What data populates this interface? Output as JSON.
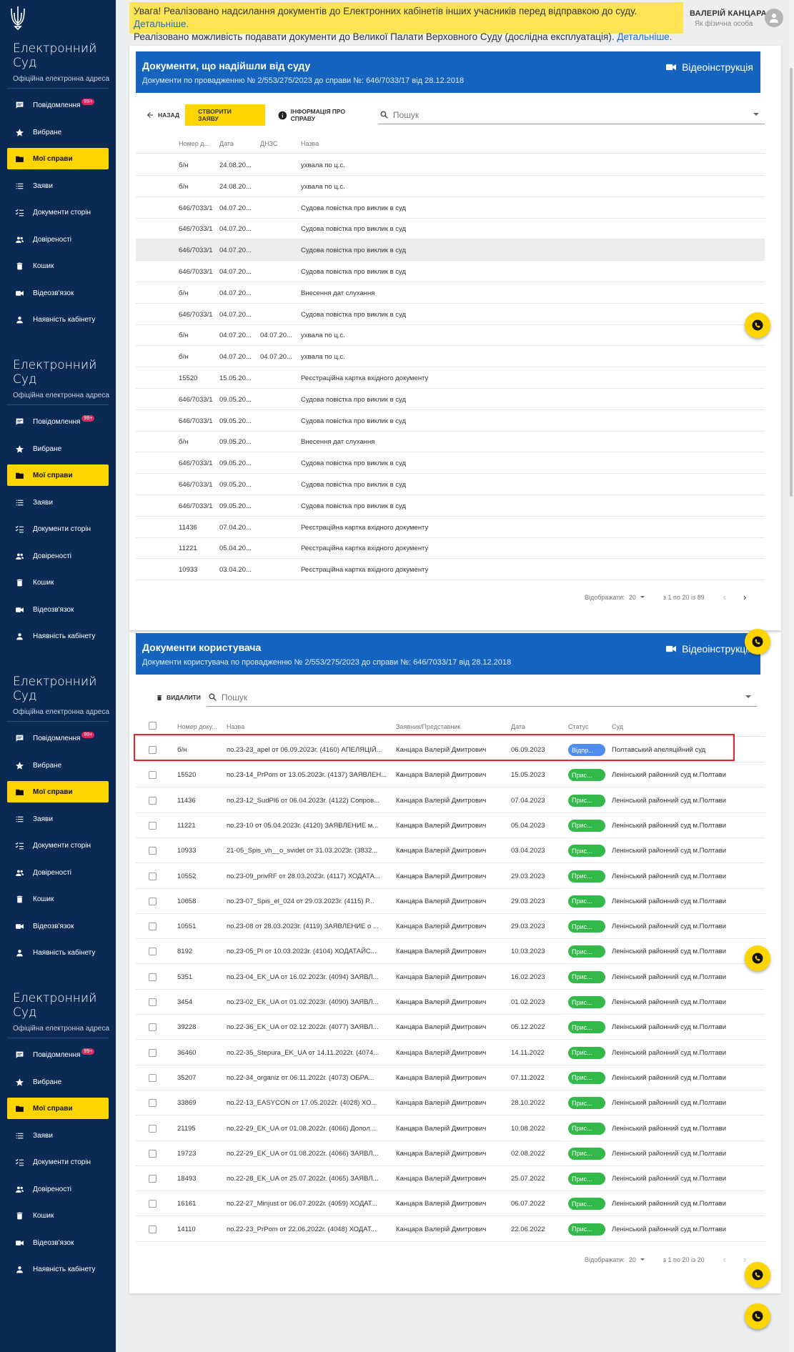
{
  "notice": {
    "line1": "Увага! Реалізовано надсилання документів до Електронних кабінетів інших учасників перед відправкою до суду.",
    "line2": "Реалізовано можливість подавати документи до Великої Палати Верховного Суду (дослідна експлуатація).",
    "link": "Детальніше."
  },
  "user": {
    "name": "ВАЛЕРІЙ КАНЦАРА",
    "role": "Як фізична особа"
  },
  "sidebar": {
    "title": "Електронний Суд",
    "subtitle": "Офіційна електронна адреса",
    "badge": "99+",
    "items": [
      {
        "label": "Повідомлення",
        "icon": "message-icon"
      },
      {
        "label": "Вибране",
        "icon": "star-icon"
      },
      {
        "label": "Мої справи",
        "icon": "folder-icon"
      },
      {
        "label": "Заяви",
        "icon": "list-icon"
      },
      {
        "label": "Документи сторін",
        "icon": "checklist-icon"
      },
      {
        "label": "Довіреності",
        "icon": "people-icon"
      },
      {
        "label": "Кошик",
        "icon": "trash-icon"
      },
      {
        "label": "Відеозв'язок",
        "icon": "video-icon"
      },
      {
        "label": "Наявність кабінету",
        "icon": "person-icon"
      }
    ]
  },
  "court_docs": {
    "title": "Документи, що надійшли від суду",
    "subtitle": "Документи по провадженню № 2/553/275/2023 до справи №: 646/7033/17 від 28.12.2018",
    "video": "Відеоінструкція",
    "back": "НАЗАД",
    "create": "СТВОРИТИ ЗАЯВУ",
    "info": "ІНФОРМАЦІЯ ПРО СПРАВУ",
    "search_placeholder": "Пошук",
    "columns": [
      "Номер д...",
      "Дата",
      "ДНЗС",
      "Назва"
    ],
    "rows": [
      [
        "б/н",
        "24.08.20...",
        "",
        "ухвала по ц.с."
      ],
      [
        "б/н",
        "24.08.20...",
        "",
        "ухвала по ц.с."
      ],
      [
        "646/7033/1",
        "04.07.20...",
        "",
        "Судова повістка про виклик в суд"
      ],
      [
        "646/7033/1",
        "04.07.20...",
        "",
        "Судова повістка про виклик в суд"
      ],
      [
        "646/7033/1",
        "04.07.20...",
        "",
        "Судова повістка про виклик в суд"
      ],
      [
        "646/7033/1",
        "04.07.20...",
        "",
        "Судова повістка про виклик в суд"
      ],
      [
        "б/н",
        "04.07.20...",
        "",
        "Внесення дат слухання"
      ],
      [
        "646/7033/1",
        "04.07.20...",
        "",
        "Судова повістка про виклик в суд"
      ],
      [
        "б/н",
        "04.07.20...",
        "04.07.20...",
        "ухвала по ц.с."
      ],
      [
        "б/н",
        "04.07.20...",
        "04.07.20...",
        "ухвала по ц.с."
      ],
      [
        "15520",
        "15.05.20...",
        "",
        "Реєстраційна картка вхідного документу"
      ],
      [
        "646/7033/1",
        "09.05.20...",
        "",
        "Судова повістка про виклик в суд"
      ],
      [
        "646/7033/1",
        "09.05.20...",
        "",
        "Судова повістка про виклик в суд"
      ],
      [
        "б/н",
        "09.05.20...",
        "",
        "Внесення дат слухання"
      ],
      [
        "646/7033/1",
        "09.05.20...",
        "",
        "Судова повістка про виклик в суд"
      ],
      [
        "646/7033/1",
        "09.05.20...",
        "",
        "Судова повістка про виклик в суд"
      ],
      [
        "646/7033/1",
        "09.05.20...",
        "",
        "Судова повістка про виклик в суд"
      ],
      [
        "11436",
        "07.04.20...",
        "",
        "Реєстраційна картка вхідного документу"
      ],
      [
        "11221",
        "05.04.20...",
        "",
        "Реєстраційна картка вхідного документу"
      ],
      [
        "10933",
        "03.04.20...",
        "",
        "Реєстраційна картка вхідного документу"
      ]
    ],
    "pager": {
      "label": "Відображати:",
      "per_page": "20",
      "range": "з 1 по 20 із 89"
    }
  },
  "user_docs": {
    "title": "Документи користувача",
    "subtitle": "Документи користувача по провадженню № 2/553/275/2023 до справи №: 646/7033/17 від 28.12.2018",
    "video": "Відеоінструкція",
    "delete": "ВИДАЛИТИ",
    "search_placeholder": "Пошук",
    "columns": [
      "Номер доку...",
      "Назва",
      "Заявник/Представник",
      "Дата",
      "Статус",
      "Суд"
    ],
    "rows": [
      [
        "б/н",
        "по.23-23_apel от 06.09.2023г. (4160) АПЕЛЯЦІЙ...",
        "Канцара Валерій Дмитрович",
        "06.09.2023",
        "Відпр...",
        "Полтавський апеляційний суд",
        "sent"
      ],
      [
        "15520",
        "по.23-14_PrPom от 13.05.2023г. (4137) ЗАЯВЛЕН...",
        "Канцара Валерій Дмитрович",
        "15.05.2023",
        "Прис...",
        "Ленінський районний суд м.Полтави",
        "ok"
      ],
      [
        "11436",
        "по.23-12_SudPl6 от 06.04.2023г. (4122) Сопров...",
        "Канцара Валерій Дмитрович",
        "07.04.2023",
        "Прис...",
        "Ленінський районний суд м.Полтави",
        "ok"
      ],
      [
        "11221",
        "по.23-10 от 05.04.2023г. (4120) ЗАЯВЛЕНИЕ м...",
        "Канцара Валерій Дмитрович",
        "05.04.2023",
        "Прис...",
        "Ленінський районний суд м.Полтави",
        "ok"
      ],
      [
        "10933",
        "21-05_Spis_vh__o_svidet от 31.03.2023г. (3832...",
        "Канцара Валерій Дмитрович",
        "03.04.2023",
        "Прис...",
        "Ленінський районний суд м.Полтави",
        "ok"
      ],
      [
        "10552",
        "по.23-09_privRF от 28.03.2023г. (4117) ХОДАТА...",
        "Канцара Валерій Дмитрович",
        "29.03.2023",
        "Прис...",
        "Ленінський районний суд м.Полтави",
        "ok"
      ],
      [
        "10658",
        "по.23-07_Spis_el_024 от 29.03.2023г. (4115) Р...",
        "Канцара Валерій Дмитрович",
        "29.03.2023",
        "Прис...",
        "Ленінський районний суд м.Полтави",
        "ok"
      ],
      [
        "10551",
        "по.23-08 от 28.03.2023г. (4119) ЗАЯВЛЕНИЕ о ...",
        "Канцара Валерій Дмитрович",
        "29.03.2023",
        "Прис...",
        "Ленінський районний суд м.Полтави",
        "ok"
      ],
      [
        "8192",
        "по.23-05_Pl от 10.03.2023г. (4104) ХОДАТАЙС...",
        "Канцара Валерій Дмитрович",
        "10.03.2023",
        "Прис...",
        "Ленінський районний суд м.Полтави",
        "ok"
      ],
      [
        "5351",
        "по.23-04_EK_UA от 16.02.2023г. (4094) ЗАЯВЛ...",
        "Канцара Валерій Дмитрович",
        "16.02.2023",
        "Прис...",
        "Ленінський районний суд м.Полтави",
        "ok"
      ],
      [
        "3454",
        "по.23-02_EK_UA от 01.02.2023г. (4090) ЗАЯВЛ...",
        "Канцара Валерій Дмитрович",
        "01.02.2023",
        "Прис...",
        "Ленінський районний суд м.Полтави",
        "ok"
      ],
      [
        "39228",
        "по.22-36_EK_UA от 02.12.2022г. (4077) ЗАЯВЛ...",
        "Канцара Валерій Дмитрович",
        "05.12.2022",
        "Прис...",
        "Ленінський районний суд м.Полтави",
        "ok"
      ],
      [
        "36460",
        "по.22-35_Stepura_EK_UA от 14.11.2022г. (4074...",
        "Канцара Валерій Дмитрович",
        "14.11.2022",
        "Прис...",
        "Ленінський районний суд м.Полтави",
        "ok"
      ],
      [
        "35207",
        "по.22-34_organiz от 06.11.2022г. (4073) ОБРА...",
        "Канцара Валерій Дмитрович",
        "07.11.2022",
        "Прис...",
        "Ленінський районний суд м.Полтави",
        "ok"
      ],
      [
        "33869",
        "по.22-13_EASYCON от 17.05.2022г. (4028) ХО...",
        "Канцара Валерій Дмитрович",
        "28.10.2022",
        "Прис...",
        "Ленінський районний суд м.Полтави",
        "ok"
      ],
      [
        "21195",
        "по.22-29_EK_UA от 01.08.2022г. (4066) Допол...",
        "Канцара Валерій Дмитрович",
        "10.08.2022",
        "Прис...",
        "Ленінський районний суд м.Полтави",
        "ok"
      ],
      [
        "19723",
        "по.22-29_EK_UA от 01.08.2022г. (4066) ЗАЯВЛ...",
        "Канцара Валерій Дмитрович",
        "02.08.2022",
        "Прис...",
        "Ленінський районний суд м.Полтави",
        "ok"
      ],
      [
        "18493",
        "по.22-28_EK_UA от 25.07.2022г. (4065) ЗАЯВЛ...",
        "Канцара Валерій Дмитрович",
        "25.07.2022",
        "Прис...",
        "Ленінський районний суд м.Полтави",
        "ok"
      ],
      [
        "16161",
        "по.22-27_Minjust от 06.07.2022г. (4059) ХОДАТ...",
        "Канцара Валерій Дмитрович",
        "06.07.2022",
        "Прис...",
        "Ленінський районний суд м.Полтави",
        "ok"
      ],
      [
        "14110",
        "по.22-23_PrPom от 22.06.2022г. (4048) ХОДАТ...",
        "Канцара Валерій Дмитрович",
        "22.06.2022",
        "Прис...",
        "Ленінський районний суд м.Полтави",
        "ok"
      ]
    ],
    "pager": {
      "label": "Відображати:",
      "per_page": "20",
      "range": "з 1 по 20 із 20"
    }
  },
  "colors": {
    "sidebar": "#0a2a54",
    "accent": "#ffd500",
    "header_blue": "#1565c0",
    "status_sent": "#4f8cf0",
    "status_ok": "#33b84a",
    "highlight": "#e3242b"
  }
}
